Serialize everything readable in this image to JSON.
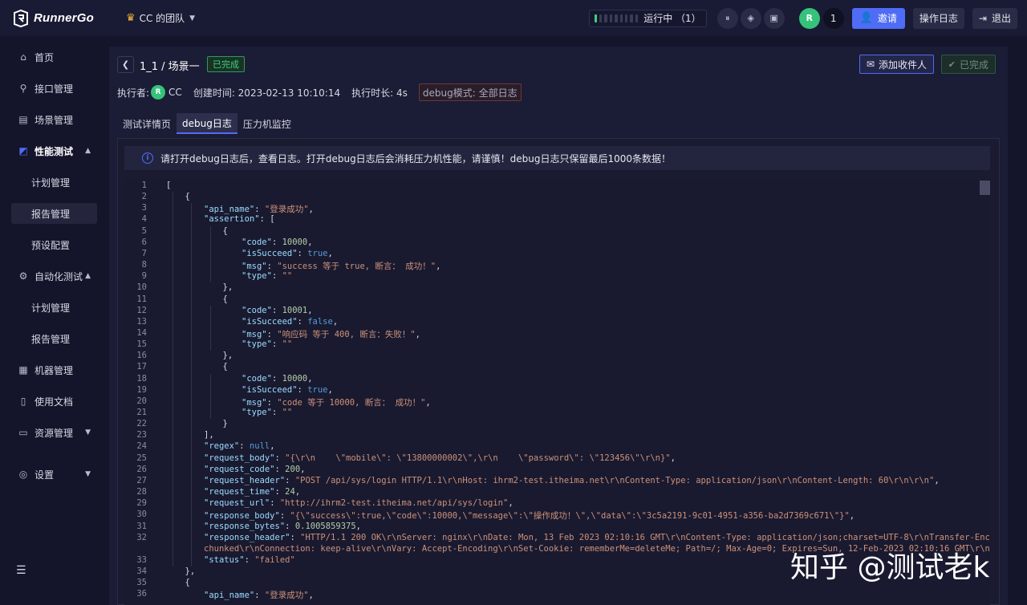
{
  "header": {
    "logo_text": "RunnerGo",
    "team_name": "CC 的团队",
    "running_status": "运行中 （1）",
    "running_progress_fraction": 0.05,
    "member_count": "1",
    "invite_label": "邀请",
    "oplog_label": "操作日志",
    "logout_label": "退出"
  },
  "sidebar": {
    "items": [
      {
        "label": "首页",
        "icon": "home-icon"
      },
      {
        "label": "接口管理",
        "icon": "api-icon"
      },
      {
        "label": "场景管理",
        "icon": "scene-icon"
      },
      {
        "label": "性能测试",
        "icon": "chart-icon"
      },
      {
        "label": "计划管理"
      },
      {
        "label": "报告管理"
      },
      {
        "label": "预设配置"
      },
      {
        "label": "自动化测试",
        "icon": "automation-icon"
      },
      {
        "label": "计划管理"
      },
      {
        "label": "报告管理"
      },
      {
        "label": "机器管理",
        "icon": "machine-icon"
      },
      {
        "label": "使用文档",
        "icon": "doc-icon"
      },
      {
        "label": "资源管理",
        "icon": "resource-icon"
      },
      {
        "label": "设置",
        "icon": "settings-icon"
      }
    ]
  },
  "report": {
    "breadcrumb": "1_1 / 场景一",
    "status_tag": "已完成",
    "add_receiver_label": "添加收件人",
    "done_label": "已完成",
    "executor_label": "执行者:",
    "executor_name": "CC",
    "created_label": "创建时间: 2023-02-13 10:10:14",
    "duration_label": "执行时长: 4s",
    "debug_mode_label": "debug模式: 全部日志"
  },
  "tabs": [
    {
      "label": "测试详情页"
    },
    {
      "label": "debug日志"
    },
    {
      "label": "压力机监控"
    }
  ],
  "notice": "请打开debug日志后，查看日志。打开debug日志后会消耗压力机性能，请谨慎！debug日志只保留最后1000条数据！",
  "code": {
    "line_numbers": [
      "1",
      "2",
      "3",
      "4",
      "5",
      "6",
      "7",
      "8",
      "9",
      "10",
      "11",
      "12",
      "13",
      "14",
      "15",
      "16",
      "17",
      "18",
      "19",
      "20",
      "21",
      "22",
      "23",
      "24",
      "25",
      "26",
      "27",
      "28",
      "29",
      "30",
      "31",
      "32",
      "",
      "33",
      "34",
      "35",
      "36"
    ],
    "line_1": "[",
    "line_2": "{",
    "line_3_key": "\"api_name\"",
    "line_3_val": "\"登录成功\"",
    "line_4_key": "\"assertion\"",
    "line_5": "{",
    "code_key": "\"code\"",
    "succ_key": "\"isSucceed\"",
    "msg_key": "\"msg\"",
    "type_key": "\"type\"",
    "empty_str": "\"\"",
    "code_1": "10000",
    "succ_1": "true",
    "msg_1": "\"success 等于 true, 断言： 成功！\"",
    "code_2": "10001",
    "succ_2": "false",
    "msg_2": "\"响应码 等于 400, 断言：失败！\"",
    "code_3": "10000",
    "succ_3": "true",
    "msg_3": "\"code 等于 10000, 断言： 成功！\"",
    "regex_key": "\"regex\"",
    "regex_val": "null",
    "req_body_key": "\"request_body\"",
    "req_body_val": "\"{\\r\\n    \\\"mobile\\\": \\\"13800000002\\\",\\r\\n    \\\"password\\\": \\\"123456\\\"\\r\\n}\"",
    "req_code_key": "\"request_code\"",
    "req_code_val": "200",
    "req_header_key": "\"request_header\"",
    "req_header_val": "\"POST /api/sys/login HTTP/1.1\\r\\nHost: ihrm2-test.itheima.net\\r\\nContent-Type: application/json\\r\\nContent-Length: 60\\r\\n\\r\\n\"",
    "req_time_key": "\"request_time\"",
    "req_time_val": "24",
    "req_url_key": "\"request_url\"",
    "req_url_val": "\"http://ihrm2-test.itheima.net/api/sys/login\"",
    "resp_body_key": "\"response_body\"",
    "resp_body_val": "\"{\\\"success\\\":true,\\\"code\\\":10000,\\\"message\\\":\\\"操作成功！\\\",\\\"data\\\":\\\"3c5a2191-9c01-4951-a356-ba2d7369c671\\\"}\"",
    "resp_bytes_key": "\"response_bytes\"",
    "resp_bytes_val": "0.1005859375",
    "resp_header_key": "\"response_header\"",
    "resp_header_val_1": "\"HTTP/1.1 200 OK\\r\\nServer: nginx\\r\\nDate: Mon, 13 Feb 2023 02:10:16 GMT\\r\\nContent-Type: application/json;charset=UTF-8\\r\\nTransfer-Encoding:",
    "resp_header_val_2": "chunked\\r\\nConnection: keep-alive\\r\\nVary: Accept-Encoding\\r\\nSet-Cookie: rememberMe=deleteMe; Path=/; Max-Age=0; Expires=Sun, 12-Feb-2023 02:10:16 GMT\\r\\n\\r\\n\",",
    "status_key": "\"status\"",
    "status_val": "\"failed\"",
    "line_34": "},",
    "line_35": "{",
    "line_36_val": "\"登录成功\""
  },
  "watermark": "知乎 @测试老k"
}
